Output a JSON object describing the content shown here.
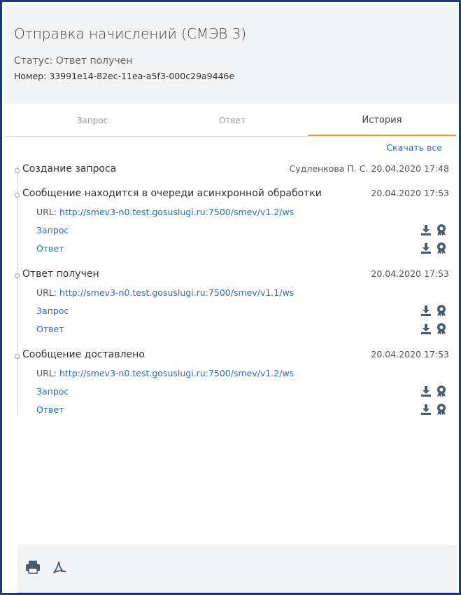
{
  "header": {
    "title": "Отправка начислений (СМЭВ 3)",
    "status": "Статус: Ответ получен",
    "number": "Номер: 33991e14-82ec-11ea-a5f3-000c29a9446e"
  },
  "tabs": [
    {
      "label": "Запрос"
    },
    {
      "label": "Ответ"
    },
    {
      "label": "История",
      "active": true
    }
  ],
  "download_all": "Скачать все",
  "events": [
    {
      "title": "Создание запроса",
      "meta": "Судленкова П. С. 20.04.2020 17:48"
    },
    {
      "title": "Сообщение находится в очереди асинхронной обработки",
      "meta": "20.04.2020 17:53",
      "url_label": "URL:",
      "url": "http://smev3-n0.test.gosuslugi.ru:7500/smev/v1.2/ws",
      "request": "Запрос",
      "response": "Ответ"
    },
    {
      "title": "Ответ получен",
      "meta": "20.04.2020 17:53",
      "url_label": "URL:",
      "url": "http://smev3-n0.test.gosuslugi.ru:7500/smev/v1.1/ws",
      "request": "Запрос",
      "response": "Ответ"
    },
    {
      "title": "Сообщение доставлено",
      "meta": "20.04.2020 17:53",
      "url_label": "URL:",
      "url": "http://smev3-n0.test.gosuslugi.ru:7500/smev/v1.2/ws",
      "request": "Запрос",
      "response": "Ответ"
    }
  ],
  "icons": {
    "download": "download-icon",
    "signature": "signature-certificate-icon",
    "print": "printer-icon",
    "pdf": "pdf-icon",
    "color": "#4a5a6a"
  }
}
